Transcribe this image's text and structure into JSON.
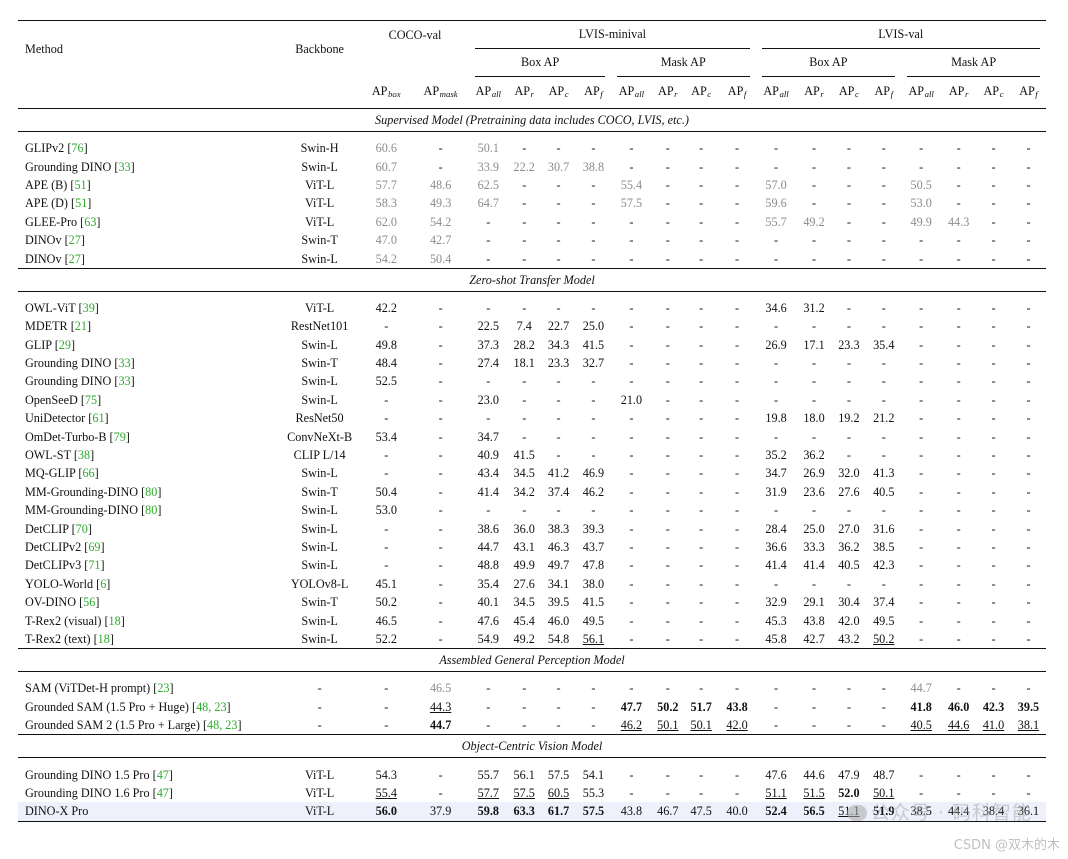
{
  "columns": {
    "method": "Method",
    "backbone": "Backbone",
    "groups": {
      "coco": "COCO-val",
      "lvis_minival": "LVIS-minival",
      "lvis_val": "LVIS-val",
      "box_ap": "Box AP",
      "mask_ap": "Mask AP"
    },
    "metrics": [
      {
        "base": "AP",
        "sub": "box"
      },
      {
        "base": "AP",
        "sub": "mask"
      },
      {
        "base": "AP",
        "sub": "all"
      },
      {
        "base": "AP",
        "sub": "r"
      },
      {
        "base": "AP",
        "sub": "c"
      },
      {
        "base": "AP",
        "sub": "f"
      },
      {
        "base": "AP",
        "sub": "all"
      },
      {
        "base": "AP",
        "sub": "r"
      },
      {
        "base": "AP",
        "sub": "c"
      },
      {
        "base": "AP",
        "sub": "f"
      },
      {
        "base": "AP",
        "sub": "all"
      },
      {
        "base": "AP",
        "sub": "r"
      },
      {
        "base": "AP",
        "sub": "c"
      },
      {
        "base": "AP",
        "sub": "f"
      },
      {
        "base": "AP",
        "sub": "all"
      },
      {
        "base": "AP",
        "sub": "r"
      },
      {
        "base": "AP",
        "sub": "c"
      },
      {
        "base": "AP",
        "sub": "f"
      }
    ]
  },
  "colors": {
    "citation": "#2dab2d",
    "gray_value": "#8c8c8c",
    "highlight_row": "#eef0fb"
  },
  "sections": [
    {
      "title": "Supervised Model (Pretraining data includes COCO, LVIS, etc.)",
      "rows": [
        {
          "name": "GLIPv2 ",
          "ref": "76",
          "backbone": "Swin-H",
          "cells": [
            "g:60.6",
            "-",
            "g:50.1",
            "-",
            "-",
            "-",
            "-",
            "-",
            "-",
            "-",
            "-",
            "-",
            "-",
            "-",
            "-",
            "-",
            "-",
            "-"
          ]
        },
        {
          "name": "Grounding DINO ",
          "ref": "33",
          "backbone": "Swin-L",
          "cells": [
            "g:60.7",
            "-",
            "g:33.9",
            "g:22.2",
            "g:30.7",
            "g:38.8",
            "-",
            "-",
            "-",
            "-",
            "-",
            "-",
            "-",
            "-",
            "-",
            "-",
            "-",
            "-"
          ]
        },
        {
          "name": "APE (B) ",
          "ref": "51",
          "backbone": "ViT-L",
          "cells": [
            "g:57.7",
            "g:48.6",
            "g:62.5",
            "-",
            "-",
            "-",
            "g:55.4",
            "-",
            "-",
            "-",
            "g:57.0",
            "-",
            "-",
            "-",
            "g:50.5",
            "-",
            "-",
            "-"
          ]
        },
        {
          "name": "APE (D) ",
          "ref": "51",
          "backbone": "ViT-L",
          "cells": [
            "g:58.3",
            "g:49.3",
            "g:64.7",
            "-",
            "-",
            "-",
            "g:57.5",
            "-",
            "-",
            "-",
            "g:59.6",
            "-",
            "-",
            "-",
            "g:53.0",
            "-",
            "-",
            "-"
          ]
        },
        {
          "name": "GLEE-Pro ",
          "ref": "63",
          "backbone": "ViT-L",
          "cells": [
            "g:62.0",
            "g:54.2",
            "-",
            "-",
            "-",
            "-",
            "-",
            "-",
            "-",
            "-",
            "g:55.7",
            "g:49.2",
            "-",
            "-",
            "g:49.9",
            "g:44.3",
            "-",
            "-"
          ]
        },
        {
          "name": "DINOv ",
          "ref": "27",
          "backbone": "Swin-T",
          "cells": [
            "g:47.0",
            "g:42.7",
            "-",
            "-",
            "-",
            "-",
            "-",
            "-",
            "-",
            "-",
            "-",
            "-",
            "-",
            "-",
            "-",
            "-",
            "-",
            "-"
          ]
        },
        {
          "name": "DINOv ",
          "ref": "27",
          "backbone": "Swin-L",
          "cells": [
            "g:54.2",
            "g:50.4",
            "-",
            "-",
            "-",
            "-",
            "-",
            "-",
            "-",
            "-",
            "-",
            "-",
            "-",
            "-",
            "-",
            "-",
            "-",
            "-"
          ]
        }
      ]
    },
    {
      "title": "Zero-shot Transfer Model",
      "rows": [
        {
          "name": "OWL-ViT ",
          "ref": "39",
          "backbone": "ViT-L",
          "cells": [
            "42.2",
            "-",
            "-",
            "-",
            "-",
            "-",
            "-",
            "-",
            "-",
            "-",
            "34.6",
            "31.2",
            "-",
            "-",
            "-",
            "-",
            "-",
            "-"
          ]
        },
        {
          "name": "MDETR ",
          "ref": "21",
          "backbone": "RestNet101",
          "cells": [
            "-",
            "-",
            "22.5",
            "7.4",
            "22.7",
            "25.0",
            "-",
            "-",
            "-",
            "-",
            "-",
            "-",
            "-",
            "-",
            "-",
            "-",
            "-",
            "-"
          ]
        },
        {
          "name": "GLIP ",
          "ref": "29",
          "backbone": "Swin-L",
          "cells": [
            "49.8",
            "-",
            "37.3",
            "28.2",
            "34.3",
            "41.5",
            "-",
            "-",
            "-",
            "-",
            "26.9",
            "17.1",
            "23.3",
            "35.4",
            "-",
            "-",
            "-",
            "-"
          ]
        },
        {
          "name": "Grounding DINO ",
          "ref": "33",
          "backbone": "Swin-T",
          "cells": [
            "48.4",
            "-",
            "27.4",
            "18.1",
            "23.3",
            "32.7",
            "-",
            "-",
            "-",
            "-",
            "-",
            "-",
            "-",
            "-",
            "-",
            "-",
            "-",
            "-"
          ]
        },
        {
          "name": "Grounding DINO ",
          "ref": "33",
          "backbone": "Swin-L",
          "cells": [
            "52.5",
            "-",
            "-",
            "-",
            "-",
            "-",
            "-",
            "-",
            "-",
            "-",
            "-",
            "-",
            "-",
            "-",
            "-",
            "-",
            "-",
            "-"
          ]
        },
        {
          "name": "OpenSeeD ",
          "ref": "75",
          "backbone": "Swin-L",
          "cells": [
            "-",
            "-",
            "23.0",
            "-",
            "-",
            "-",
            "21.0",
            "-",
            "-",
            "-",
            "-",
            "-",
            "-",
            "-",
            "-",
            "-",
            "-",
            "-"
          ]
        },
        {
          "name": "UniDetector ",
          "ref": "61",
          "backbone": "ResNet50",
          "cells": [
            "-",
            "-",
            "-",
            "-",
            "-",
            "-",
            "-",
            "-",
            "-",
            "-",
            "19.8",
            "18.0",
            "19.2",
            "21.2",
            "-",
            "-",
            "-",
            "-"
          ]
        },
        {
          "name": "OmDet-Turbo-B ",
          "ref": "79",
          "backbone": "ConvNeXt-B",
          "cells": [
            "53.4",
            "-",
            "34.7",
            "-",
            "-",
            "-",
            "-",
            "-",
            "-",
            "-",
            "-",
            "-",
            "-",
            "-",
            "-",
            "-",
            "-",
            "-"
          ]
        },
        {
          "name": "OWL-ST ",
          "ref": "38",
          "backbone": "CLIP L/14",
          "cells": [
            "-",
            "-",
            "40.9",
            "41.5",
            "-",
            "-",
            "-",
            "-",
            "-",
            "-",
            "35.2",
            "36.2",
            "-",
            "-",
            "-",
            "-",
            "-",
            "-"
          ]
        },
        {
          "name": "MQ-GLIP ",
          "ref": "66",
          "backbone": "Swin-L",
          "cells": [
            "-",
            "-",
            "43.4",
            "34.5",
            "41.2",
            "46.9",
            "-",
            "-",
            "-",
            "-",
            "34.7",
            "26.9",
            "32.0",
            "41.3",
            "-",
            "-",
            "-",
            "-"
          ]
        },
        {
          "name": "MM-Grounding-DINO ",
          "ref": "80",
          "backbone": "Swin-T",
          "cells": [
            "50.4",
            "-",
            "41.4",
            "34.2",
            "37.4",
            "46.2",
            "-",
            "-",
            "-",
            "-",
            "31.9",
            "23.6",
            "27.6",
            "40.5",
            "-",
            "-",
            "-",
            "-"
          ]
        },
        {
          "name": "MM-Grounding-DINO ",
          "ref": "80",
          "backbone": "Swin-L",
          "cells": [
            "53.0",
            "-",
            "-",
            "-",
            "-",
            "-",
            "-",
            "-",
            "-",
            "-",
            "-",
            "-",
            "-",
            "-",
            "-",
            "-",
            "-",
            "-"
          ]
        },
        {
          "name": "DetCLIP ",
          "ref": "70",
          "backbone": "Swin-L",
          "cells": [
            "-",
            "-",
            "38.6",
            "36.0",
            "38.3",
            "39.3",
            "-",
            "-",
            "-",
            "-",
            "28.4",
            "25.0",
            "27.0",
            "31.6",
            "-",
            "-",
            "-",
            "-"
          ]
        },
        {
          "name": "DetCLIPv2 ",
          "ref": "69",
          "backbone": "Swin-L",
          "cells": [
            "-",
            "-",
            "44.7",
            "43.1",
            "46.3",
            "43.7",
            "-",
            "-",
            "-",
            "-",
            "36.6",
            "33.3",
            "36.2",
            "38.5",
            "-",
            "-",
            "-",
            "-"
          ]
        },
        {
          "name": "DetCLIPv3 ",
          "ref": "71",
          "backbone": "Swin-L",
          "cells": [
            "-",
            "-",
            "48.8",
            "49.9",
            "49.7",
            "47.8",
            "-",
            "-",
            "-",
            "-",
            "41.4",
            "41.4",
            "40.5",
            "42.3",
            "-",
            "-",
            "-",
            "-"
          ]
        },
        {
          "name": "YOLO-World ",
          "ref": "6",
          "backbone": "YOLOv8-L",
          "cells": [
            "45.1",
            "-",
            "35.4",
            "27.6",
            "34.1",
            "38.0",
            "-",
            "-",
            "-",
            "-",
            "-",
            "-",
            "-",
            "-",
            "-",
            "-",
            "-",
            "-"
          ]
        },
        {
          "name": "OV-DINO ",
          "ref": "56",
          "backbone": "Swin-T",
          "cells": [
            "50.2",
            "-",
            "40.1",
            "34.5",
            "39.5",
            "41.5",
            "-",
            "-",
            "-",
            "-",
            "32.9",
            "29.1",
            "30.4",
            "37.4",
            "-",
            "-",
            "-",
            "-"
          ]
        },
        {
          "name": "T-Rex2 (visual) ",
          "ref": "18",
          "backbone": "Swin-L",
          "cells": [
            "46.5",
            "-",
            "47.6",
            "45.4",
            "46.0",
            "49.5",
            "-",
            "-",
            "-",
            "-",
            "45.3",
            "43.8",
            "42.0",
            "49.5",
            "-",
            "-",
            "-",
            "-"
          ]
        },
        {
          "name": "T-Rex2 (text) ",
          "ref": "18",
          "backbone": "Swin-L",
          "cells": [
            "52.2",
            "-",
            "54.9",
            "49.2",
            "54.8",
            "u:56.1",
            "-",
            "-",
            "-",
            "-",
            "45.8",
            "42.7",
            "43.2",
            "u:50.2",
            "-",
            "-",
            "-",
            "-"
          ]
        }
      ]
    },
    {
      "title": "Assembled General Perception Model",
      "rows": [
        {
          "name": "SAM (ViTDet-H prompt) ",
          "ref": "23",
          "backbone": "-",
          "cells": [
            "-",
            "g:46.5",
            "-",
            "-",
            "-",
            "-",
            "-",
            "-",
            "-",
            "-",
            "-",
            "-",
            "-",
            "-",
            "g:44.7",
            "-",
            "-",
            "-"
          ]
        },
        {
          "name": "Grounded SAM (1.5 Pro + Huge) ",
          "ref": "48, 23",
          "backbone": "-",
          "cells": [
            "-",
            "u:44.3",
            "-",
            "-",
            "-",
            "-",
            "b:47.7",
            "b:50.2",
            "b:51.7",
            "b:43.8",
            "-",
            "-",
            "-",
            "-",
            "b:41.8",
            "b:46.0",
            "b:42.3",
            "b:39.5"
          ]
        },
        {
          "name": "Grounded SAM 2 (1.5 Pro + Large) ",
          "ref": "48, 23",
          "backbone": "-",
          "cells": [
            "-",
            "b:44.7",
            "-",
            "-",
            "-",
            "-",
            "u:46.2",
            "u:50.1",
            "u:50.1",
            "u:42.0",
            "-",
            "-",
            "-",
            "-",
            "u:40.5",
            "u:44.6",
            "u:41.0",
            "u:38.1"
          ]
        }
      ]
    },
    {
      "title": "Object-Centric Vision Model",
      "rows": [
        {
          "name": "Grounding DINO 1.5 Pro ",
          "ref": "47",
          "backbone": "ViT-L",
          "cells": [
            "54.3",
            "-",
            "55.7",
            "56.1",
            "57.5",
            "54.1",
            "-",
            "-",
            "-",
            "-",
            "47.6",
            "44.6",
            "47.9",
            "48.7",
            "-",
            "-",
            "-",
            "-"
          ]
        },
        {
          "name": "Grounding DINO 1.6 Pro ",
          "ref": "47",
          "backbone": "ViT-L",
          "cells": [
            "u:55.4",
            "-",
            "u:57.7",
            "u:57.5",
            "u:60.5",
            "55.3",
            "-",
            "-",
            "-",
            "-",
            "u:51.1",
            "u:51.5",
            "b:52.0",
            "u:50.1",
            "-",
            "-",
            "-",
            "-"
          ]
        },
        {
          "name": "DINO-X Pro",
          "ref": "",
          "backbone": "ViT-L",
          "highlight": true,
          "cells": [
            "b:56.0",
            "37.9",
            "b:59.8",
            "b:63.3",
            "b:61.7",
            "b:57.5",
            "43.8",
            "46.7",
            "47.5",
            "40.0",
            "b:52.4",
            "b:56.5",
            "u:51.1",
            "b:51.9",
            "38.5",
            "44.4",
            "38.4",
            "36.1"
          ]
        }
      ]
    }
  ],
  "watermark": {
    "main": "公众号 · 码科智能",
    "sub": "CSDN @双木的木"
  }
}
